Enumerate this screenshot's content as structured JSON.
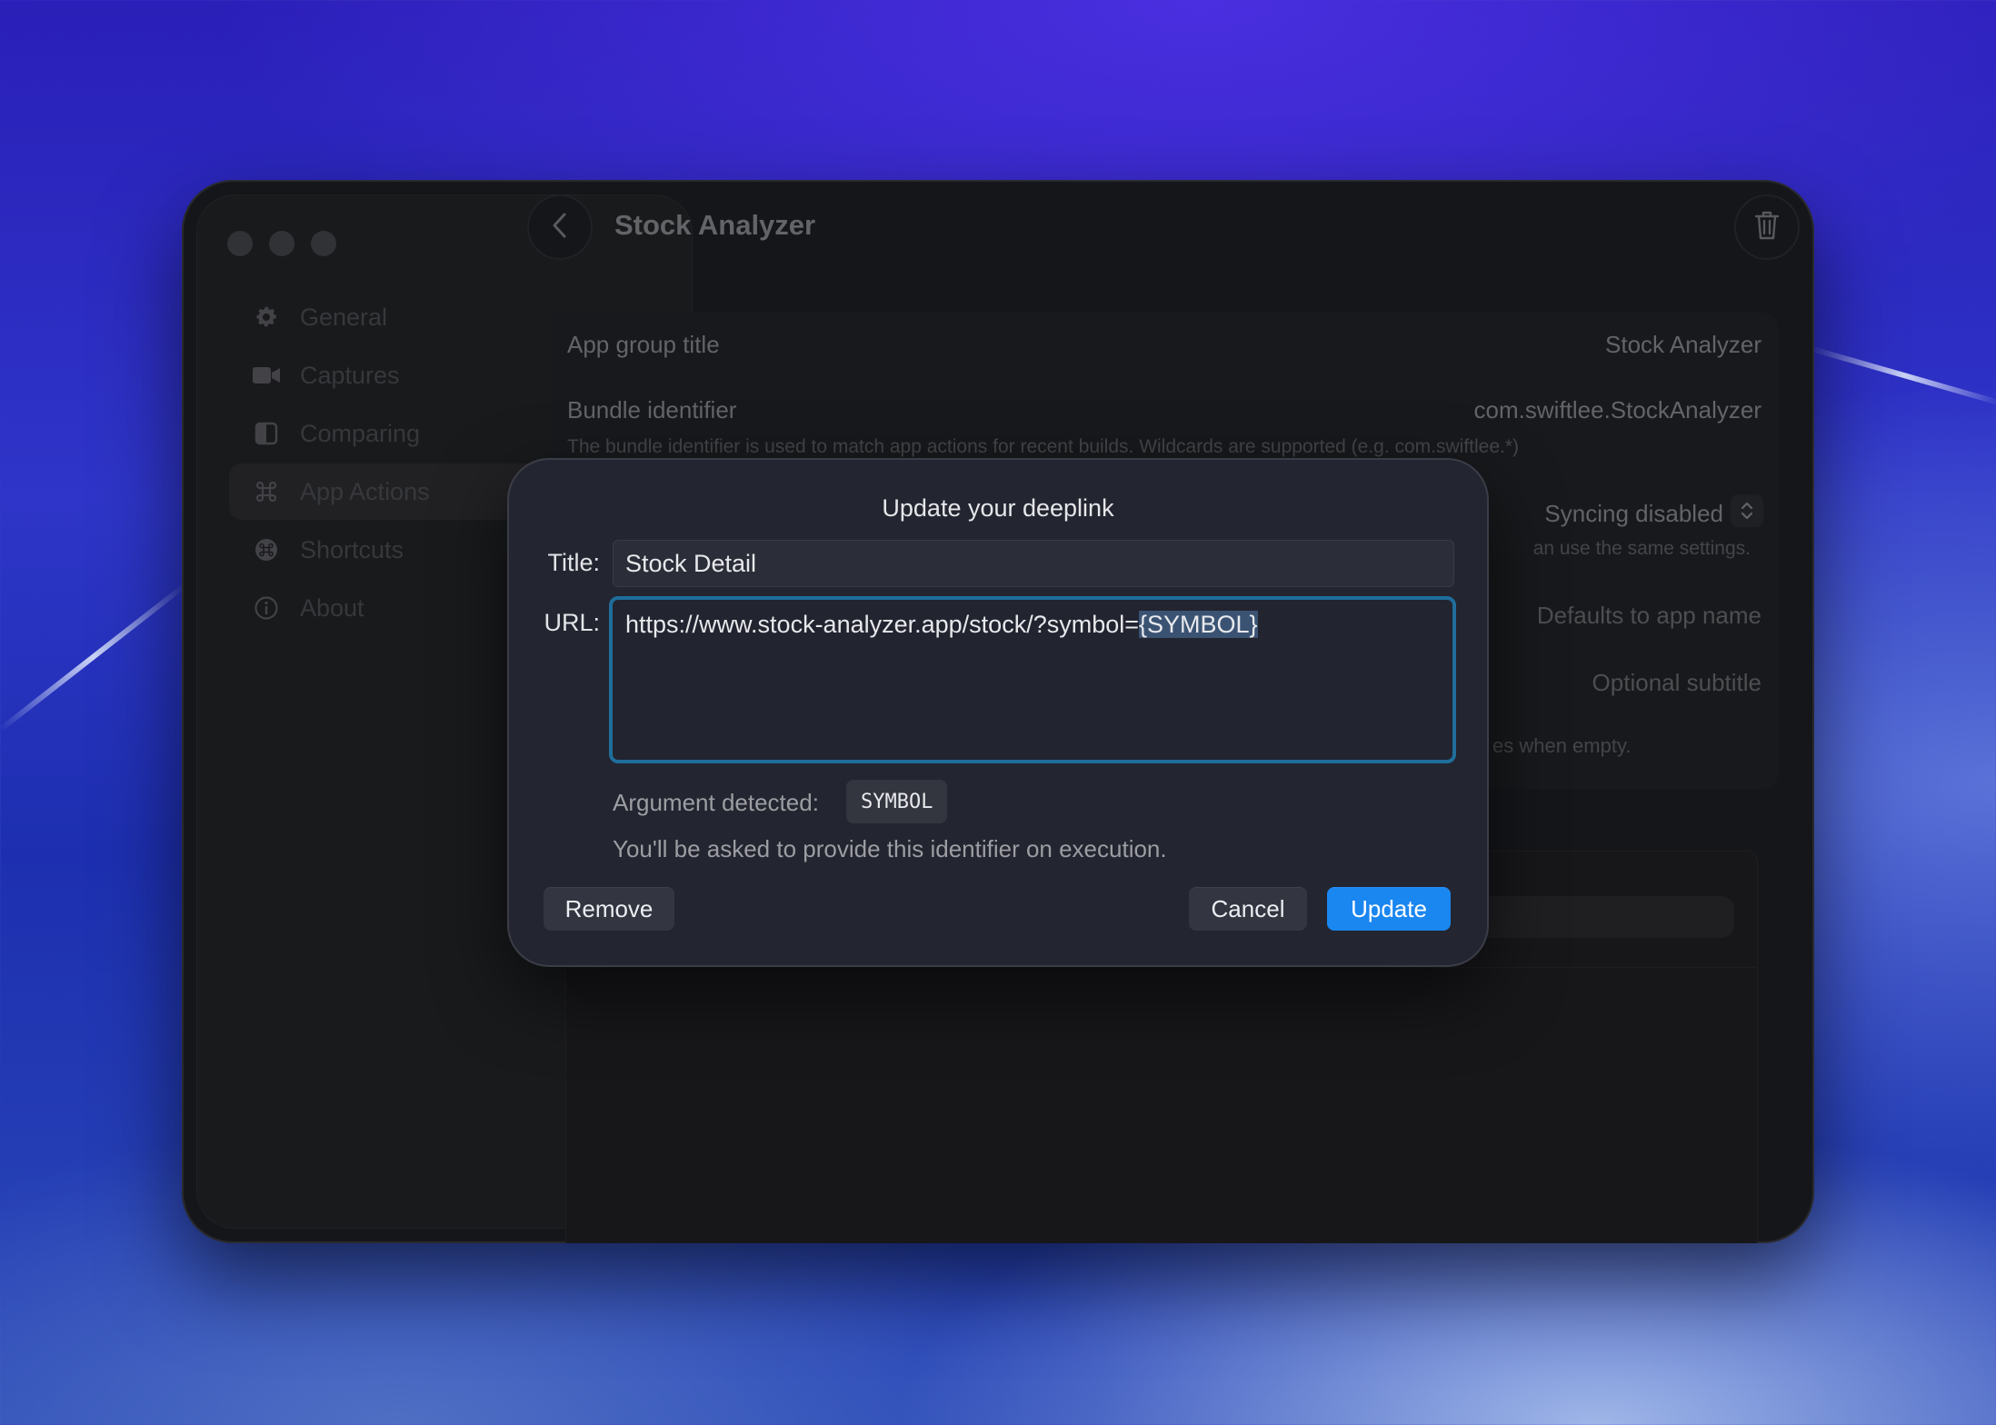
{
  "window": {
    "title": "Stock Analyzer"
  },
  "sidebar": {
    "items": [
      {
        "label": "General",
        "icon": "gear-icon"
      },
      {
        "label": "Captures",
        "icon": "video-camera-icon"
      },
      {
        "label": "Comparing",
        "icon": "split-view-icon"
      },
      {
        "label": "App Actions",
        "icon": "command-icon"
      },
      {
        "label": "Shortcuts",
        "icon": "shortcuts-icon"
      },
      {
        "label": "About",
        "icon": "info-icon"
      }
    ],
    "active": "App Actions"
  },
  "settings": {
    "app_group_title_label": "App group title",
    "app_group_title_value": "Stock Analyzer",
    "bundle_identifier_label": "Bundle identifier",
    "bundle_identifier_value": "com.swiftlee.StockAnalyzer",
    "bundle_help": "The bundle identifier is used to match app actions for recent builds. Wildcards are supported (e.g. com.swiftlee.*)",
    "sync_value": "Syncing disabled",
    "sync_help_partial": "an use the same settings.",
    "name_placeholder": "Defaults to app name",
    "subtitle_placeholder": "Optional subtitle",
    "empty_help_partial": "es when empty."
  },
  "dialog": {
    "title": "Update your deeplink",
    "title_label": "Title:",
    "title_value": "Stock Detail",
    "url_label": "URL:",
    "url_prefix": "https://www.stock-analyzer.app/stock/?symbol=",
    "url_selected": "{SYMBOL}",
    "argument_label": "Argument detected:",
    "argument_value": "SYMBOL",
    "argument_note": "You'll be asked to provide this identifier on execution.",
    "remove_label": "Remove",
    "cancel_label": "Cancel",
    "update_label": "Update"
  },
  "colors": {
    "accent": "#1a86f0",
    "focus_ring": "#1f6e9c",
    "selection": "#3b5373"
  }
}
